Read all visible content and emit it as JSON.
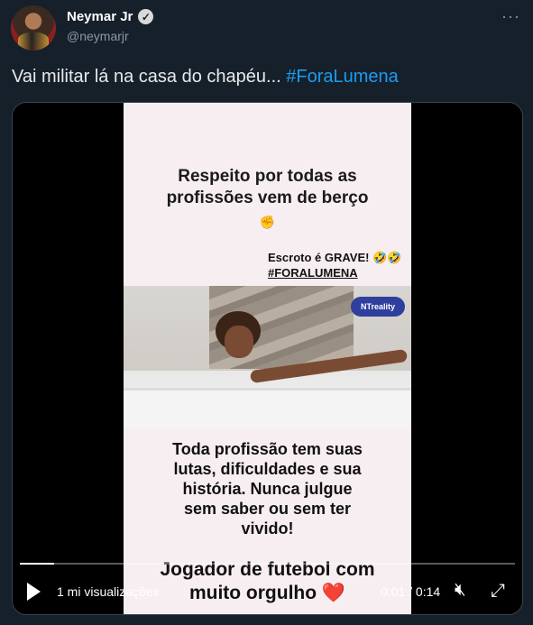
{
  "author": {
    "name": "Neymar Jr",
    "handle": "@neymarjr",
    "verified_icon": "verified-badge-icon",
    "more_icon": "more-options-icon"
  },
  "tweet": {
    "text": "Vai militar lá na casa do chapéu... ",
    "hashtag": "#ForaLumena"
  },
  "video": {
    "caption_1_line_1": "Respeito por todas as",
    "caption_1_line_2": "profissões vem de berço",
    "caption_2_line_1": "Escroto é GRAVE! 🤣🤣",
    "caption_2_line_2": "#FORALUMENA",
    "watermark": "NTreality",
    "caption_3_line_1": "Toda profissão tem suas",
    "caption_3_line_2": "lutas, dificuldades e sua",
    "caption_3_line_3": "história. Nunca julgue",
    "caption_3_line_4": "sem saber ou sem ter",
    "caption_3_line_5": "vivido!",
    "caption_4_line_1": "Jogador de futebol com",
    "caption_4_line_2": "muito orgulho ❤️",
    "progress_fraction": 0.07
  },
  "controls": {
    "views": "1 mi visualizações",
    "time": "0:01 / 0:14",
    "play_icon": "play-icon",
    "mute_icon": "mute-icon",
    "fullscreen_icon": "fullscreen-icon"
  },
  "colors": {
    "background": "#15202b",
    "hashtag": "#1d9bf0",
    "secondary_text": "#8b98a5"
  }
}
